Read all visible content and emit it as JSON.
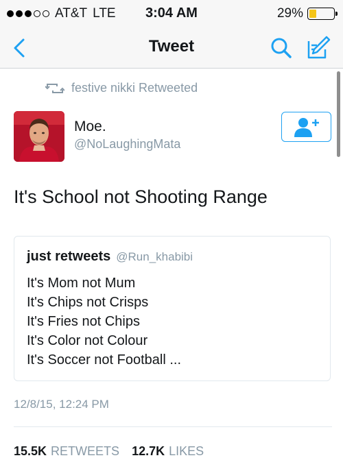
{
  "status_bar": {
    "carrier": "AT&T",
    "network": "LTE",
    "time": "3:04 AM",
    "battery": "29%",
    "battery_level": 0.29
  },
  "nav": {
    "title": "Tweet",
    "back_icon": "chevron-left-icon",
    "search_icon": "search-icon",
    "compose_icon": "compose-icon",
    "accent_color": "#1da1f2"
  },
  "retweet": {
    "text": "festive nikki Retweeted",
    "icon": "retweet-icon"
  },
  "user": {
    "name": "Moe.",
    "handle": "@NoLaughingMata",
    "follow_icon": "add-user-icon"
  },
  "tweet": {
    "text": "It's School not Shooting Range",
    "timestamp": "12/8/15, 12:24 PM"
  },
  "quoted_tweet": {
    "name": "just retweets",
    "handle": "@Run_khabibi",
    "lines": [
      "It's Mom not Mum",
      "It's Chips not Crisps",
      "It's Fries not Chips",
      "It's Color not Colour",
      "It's Soccer not Football ..."
    ]
  },
  "stats": {
    "retweets_count": "15.5K",
    "retweets_label": "RETWEETS",
    "likes_count": "12.7K",
    "likes_label": "LIKES"
  }
}
